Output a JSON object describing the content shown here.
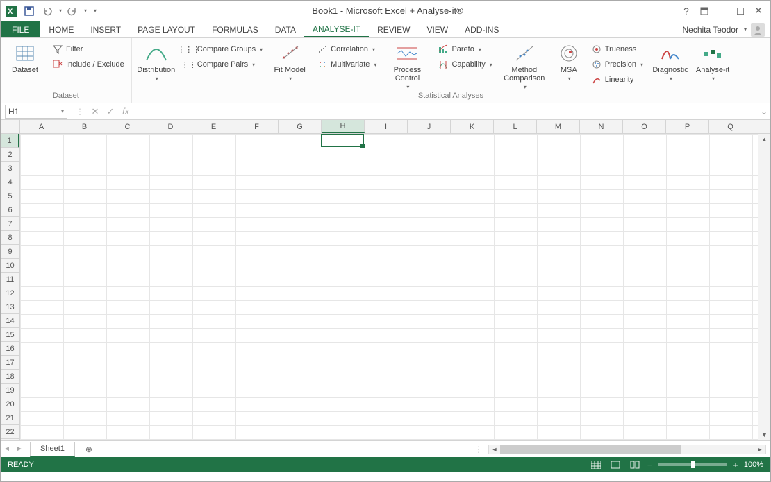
{
  "title": "Book1 - Microsoft Excel + Analyse-it®",
  "user": "Nechita Teodor",
  "tabs": {
    "file": "FILE",
    "list": [
      "HOME",
      "INSERT",
      "PAGE LAYOUT",
      "FORMULAS",
      "DATA",
      "ANALYSE-IT",
      "REVIEW",
      "VIEW",
      "ADD-INS"
    ],
    "active": "ANALYSE-IT"
  },
  "ribbon": {
    "dataset": {
      "label": "Dataset",
      "dataset": "Dataset",
      "filter": "Filter",
      "include_exclude": "Include / Exclude"
    },
    "stat": {
      "label": "Statistical Analyses",
      "distribution": "Distribution",
      "compare_groups": "Compare Groups",
      "compare_pairs": "Compare Pairs",
      "fit_model": "Fit Model",
      "correlation": "Correlation",
      "multivariate": "Multivariate",
      "process_control": "Process Control",
      "pareto": "Pareto",
      "capability": "Capability",
      "method_comparison": "Method Comparison",
      "msa": "MSA",
      "trueness": "Trueness",
      "precision": "Precision",
      "linearity": "Linearity",
      "diagnostic": "Diagnostic",
      "analyse_it": "Analyse-it"
    }
  },
  "namebox": "H1",
  "columns": [
    "A",
    "B",
    "C",
    "D",
    "E",
    "F",
    "G",
    "H",
    "I",
    "J",
    "K",
    "L",
    "M",
    "N",
    "O",
    "P",
    "Q"
  ],
  "selected_col": "H",
  "rows": [
    1,
    2,
    3,
    4,
    5,
    6,
    7,
    8,
    9,
    10,
    11,
    12,
    13,
    14,
    15,
    16,
    17,
    18,
    19,
    20,
    21,
    22
  ],
  "selected_row": 1,
  "sheet": "Sheet1",
  "status": "READY",
  "zoom": "100%"
}
